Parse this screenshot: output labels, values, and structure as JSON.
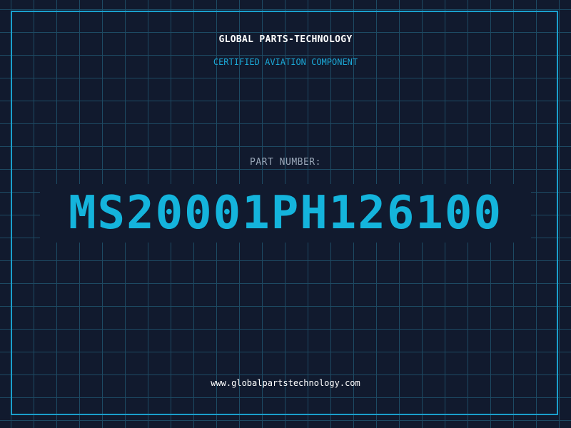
{
  "header": {
    "company": "GLOBAL PARTS-TECHNOLOGY",
    "tagline": "CERTIFIED AVIATION COMPONENT"
  },
  "part": {
    "label": "PART NUMBER:",
    "number": "MS20001PH126100"
  },
  "footer": {
    "website": "www.globalpartstechnology.com"
  },
  "colors": {
    "background": "#111a2e",
    "grid": "#1d4a63",
    "accent": "#14b4dc",
    "frame": "#1a9fcc"
  }
}
